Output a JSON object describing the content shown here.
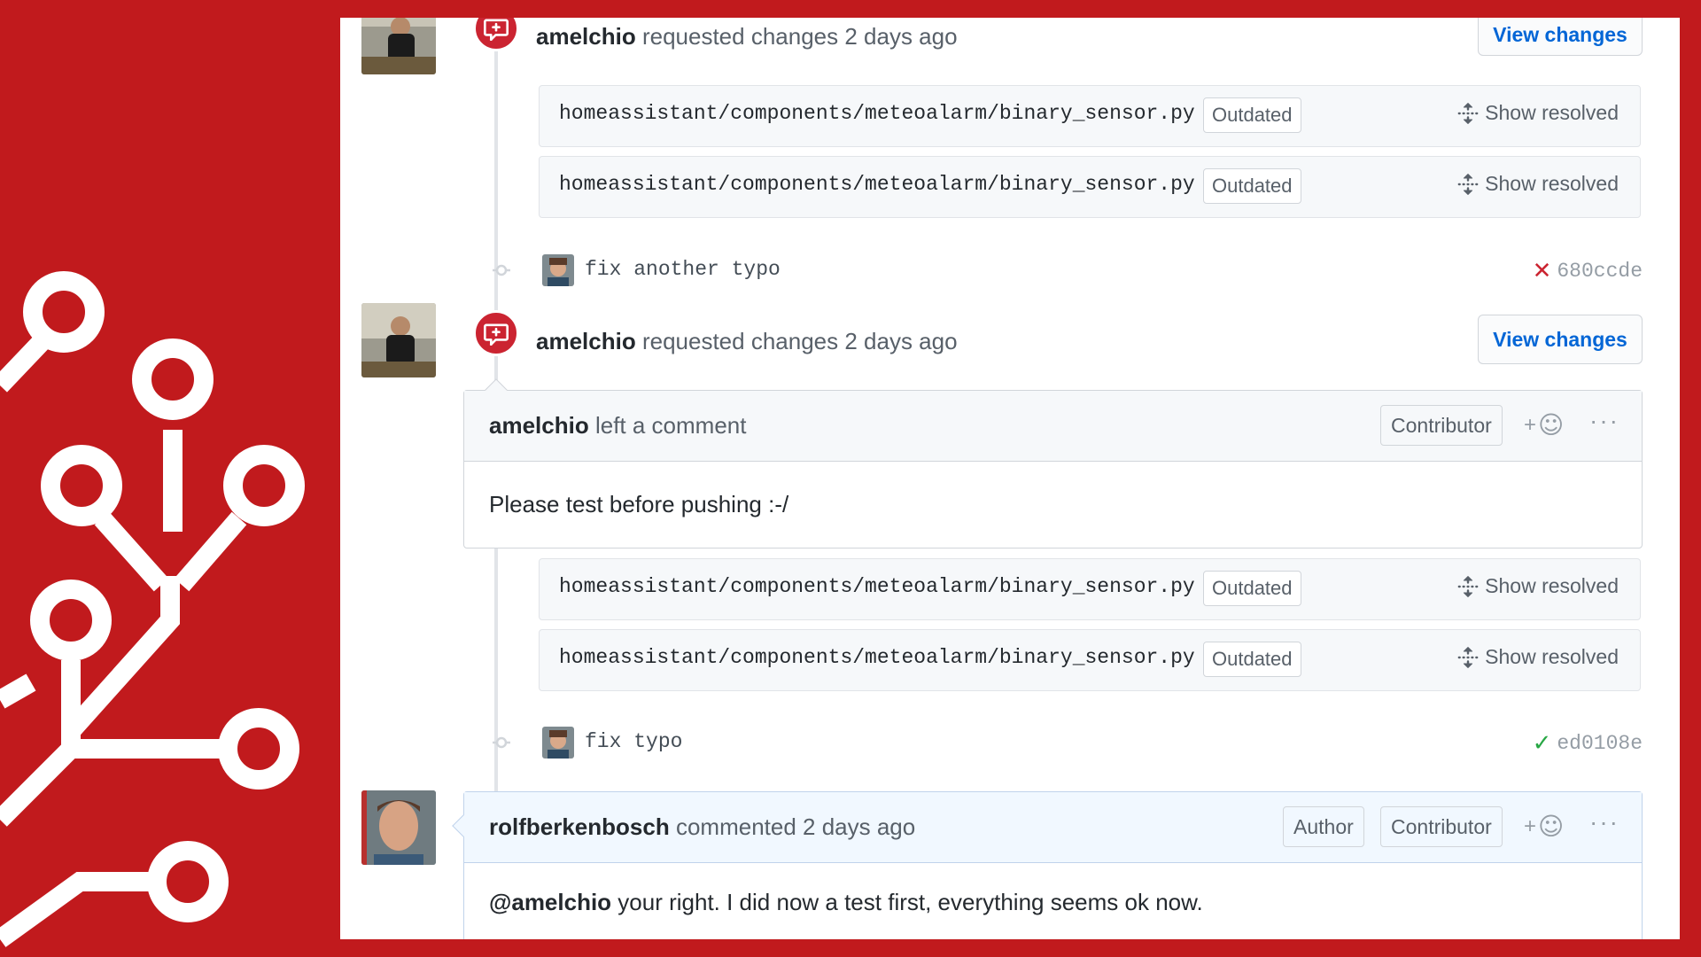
{
  "colors": {
    "frame": "#c11a1d",
    "review_red": "#cb2431",
    "link_blue": "#0366d6",
    "success_green": "#28a745"
  },
  "events": [
    {
      "author": "amelchio",
      "action": "requested changes 2 days ago",
      "button": "View changes",
      "files": [
        {
          "path": "homeassistant/components/meteoalarm/binary_sensor.py",
          "badge": "Outdated",
          "action": "Show resolved"
        },
        {
          "path": "homeassistant/components/meteoalarm/binary_sensor.py",
          "badge": "Outdated",
          "action": "Show resolved"
        }
      ]
    },
    {
      "author": "amelchio",
      "action": "requested changes 2 days ago",
      "button": "View changes",
      "comment": {
        "author": "amelchio",
        "action": "left a comment",
        "badge": "Contributor",
        "body": "Please test before pushing :-/"
      },
      "files": [
        {
          "path": "homeassistant/components/meteoalarm/binary_sensor.py",
          "badge": "Outdated",
          "action": "Show resolved"
        },
        {
          "path": "homeassistant/components/meteoalarm/binary_sensor.py",
          "badge": "Outdated",
          "action": "Show resolved"
        }
      ]
    }
  ],
  "commits": [
    {
      "message": "fix another typo",
      "sha": "680ccde",
      "status": "failure"
    },
    {
      "message": "fix typo",
      "sha": "ed0108e",
      "status": "success"
    }
  ],
  "final_comment": {
    "author": "rolfberkenbosch",
    "action": "commented 2 days ago",
    "badges": [
      "Author",
      "Contributor"
    ],
    "mention": "@amelchio",
    "body": " your right. I did now a test first, everything seems ok now."
  },
  "reaction_plus": "+",
  "more_symbol": "···"
}
